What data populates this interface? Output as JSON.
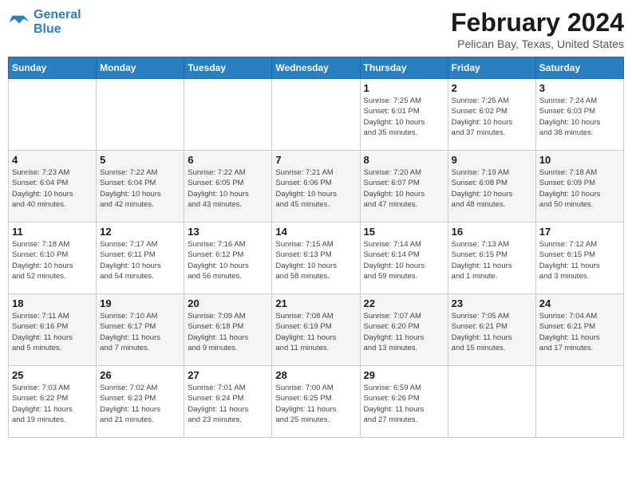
{
  "logo": {
    "line1": "General",
    "line2": "Blue"
  },
  "title": "February 2024",
  "subtitle": "Pelican Bay, Texas, United States",
  "days_of_week": [
    "Sunday",
    "Monday",
    "Tuesday",
    "Wednesday",
    "Thursday",
    "Friday",
    "Saturday"
  ],
  "weeks": [
    [
      {
        "day": "",
        "info": ""
      },
      {
        "day": "",
        "info": ""
      },
      {
        "day": "",
        "info": ""
      },
      {
        "day": "",
        "info": ""
      },
      {
        "day": "1",
        "info": "Sunrise: 7:25 AM\nSunset: 6:01 PM\nDaylight: 10 hours\nand 35 minutes."
      },
      {
        "day": "2",
        "info": "Sunrise: 7:25 AM\nSunset: 6:02 PM\nDaylight: 10 hours\nand 37 minutes."
      },
      {
        "day": "3",
        "info": "Sunrise: 7:24 AM\nSunset: 6:03 PM\nDaylight: 10 hours\nand 38 minutes."
      }
    ],
    [
      {
        "day": "4",
        "info": "Sunrise: 7:23 AM\nSunset: 6:04 PM\nDaylight: 10 hours\nand 40 minutes."
      },
      {
        "day": "5",
        "info": "Sunrise: 7:22 AM\nSunset: 6:04 PM\nDaylight: 10 hours\nand 42 minutes."
      },
      {
        "day": "6",
        "info": "Sunrise: 7:22 AM\nSunset: 6:05 PM\nDaylight: 10 hours\nand 43 minutes."
      },
      {
        "day": "7",
        "info": "Sunrise: 7:21 AM\nSunset: 6:06 PM\nDaylight: 10 hours\nand 45 minutes."
      },
      {
        "day": "8",
        "info": "Sunrise: 7:20 AM\nSunset: 6:07 PM\nDaylight: 10 hours\nand 47 minutes."
      },
      {
        "day": "9",
        "info": "Sunrise: 7:19 AM\nSunset: 6:08 PM\nDaylight: 10 hours\nand 48 minutes."
      },
      {
        "day": "10",
        "info": "Sunrise: 7:18 AM\nSunset: 6:09 PM\nDaylight: 10 hours\nand 50 minutes."
      }
    ],
    [
      {
        "day": "11",
        "info": "Sunrise: 7:18 AM\nSunset: 6:10 PM\nDaylight: 10 hours\nand 52 minutes."
      },
      {
        "day": "12",
        "info": "Sunrise: 7:17 AM\nSunset: 6:11 PM\nDaylight: 10 hours\nand 54 minutes."
      },
      {
        "day": "13",
        "info": "Sunrise: 7:16 AM\nSunset: 6:12 PM\nDaylight: 10 hours\nand 56 minutes."
      },
      {
        "day": "14",
        "info": "Sunrise: 7:15 AM\nSunset: 6:13 PM\nDaylight: 10 hours\nand 58 minutes."
      },
      {
        "day": "15",
        "info": "Sunrise: 7:14 AM\nSunset: 6:14 PM\nDaylight: 10 hours\nand 59 minutes."
      },
      {
        "day": "16",
        "info": "Sunrise: 7:13 AM\nSunset: 6:15 PM\nDaylight: 11 hours\nand 1 minute."
      },
      {
        "day": "17",
        "info": "Sunrise: 7:12 AM\nSunset: 6:15 PM\nDaylight: 11 hours\nand 3 minutes."
      }
    ],
    [
      {
        "day": "18",
        "info": "Sunrise: 7:11 AM\nSunset: 6:16 PM\nDaylight: 11 hours\nand 5 minutes."
      },
      {
        "day": "19",
        "info": "Sunrise: 7:10 AM\nSunset: 6:17 PM\nDaylight: 11 hours\nand 7 minutes."
      },
      {
        "day": "20",
        "info": "Sunrise: 7:09 AM\nSunset: 6:18 PM\nDaylight: 11 hours\nand 9 minutes."
      },
      {
        "day": "21",
        "info": "Sunrise: 7:08 AM\nSunset: 6:19 PM\nDaylight: 11 hours\nand 11 minutes."
      },
      {
        "day": "22",
        "info": "Sunrise: 7:07 AM\nSunset: 6:20 PM\nDaylight: 11 hours\nand 13 minutes."
      },
      {
        "day": "23",
        "info": "Sunrise: 7:05 AM\nSunset: 6:21 PM\nDaylight: 11 hours\nand 15 minutes."
      },
      {
        "day": "24",
        "info": "Sunrise: 7:04 AM\nSunset: 6:21 PM\nDaylight: 11 hours\nand 17 minutes."
      }
    ],
    [
      {
        "day": "25",
        "info": "Sunrise: 7:03 AM\nSunset: 6:22 PM\nDaylight: 11 hours\nand 19 minutes."
      },
      {
        "day": "26",
        "info": "Sunrise: 7:02 AM\nSunset: 6:23 PM\nDaylight: 11 hours\nand 21 minutes."
      },
      {
        "day": "27",
        "info": "Sunrise: 7:01 AM\nSunset: 6:24 PM\nDaylight: 11 hours\nand 23 minutes."
      },
      {
        "day": "28",
        "info": "Sunrise: 7:00 AM\nSunset: 6:25 PM\nDaylight: 11 hours\nand 25 minutes."
      },
      {
        "day": "29",
        "info": "Sunrise: 6:59 AM\nSunset: 6:26 PM\nDaylight: 11 hours\nand 27 minutes."
      },
      {
        "day": "",
        "info": ""
      },
      {
        "day": "",
        "info": ""
      }
    ]
  ]
}
